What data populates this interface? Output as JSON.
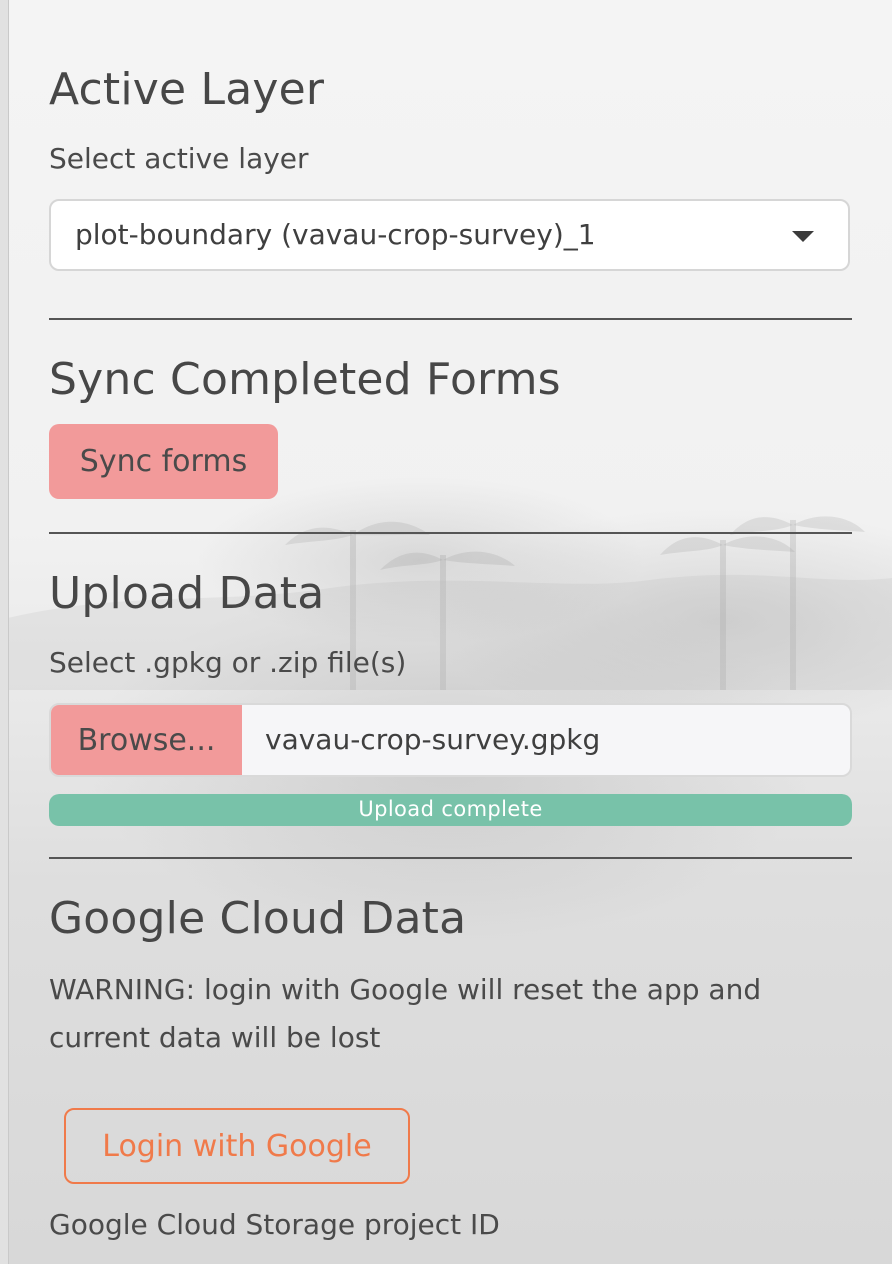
{
  "active_layer": {
    "heading": "Active Layer",
    "select_label": "Select active layer",
    "selected_value": "plot-boundary (vavau-crop-survey)_1"
  },
  "sync": {
    "heading": "Sync Completed Forms",
    "button_label": "Sync forms"
  },
  "upload": {
    "heading": "Upload Data",
    "file_label": "Select .gpkg or .zip file(s)",
    "browse_label": "Browse...",
    "file_name": "vavau-crop-survey.gpkg",
    "progress_text": "Upload complete",
    "progress_fraction": 1.0
  },
  "google": {
    "heading": "Google Cloud Data",
    "warning": "WARNING: login with Google will reset the app and current data will be lost",
    "login_label": "Login with Google",
    "project_id_label": "Google Cloud Storage project ID"
  },
  "colors": {
    "primary_button": "#f29a9a",
    "progress_success": "#78c2a9",
    "outline_accent": "#f07a4a"
  },
  "icons": {
    "select_caret": "caret-down"
  }
}
